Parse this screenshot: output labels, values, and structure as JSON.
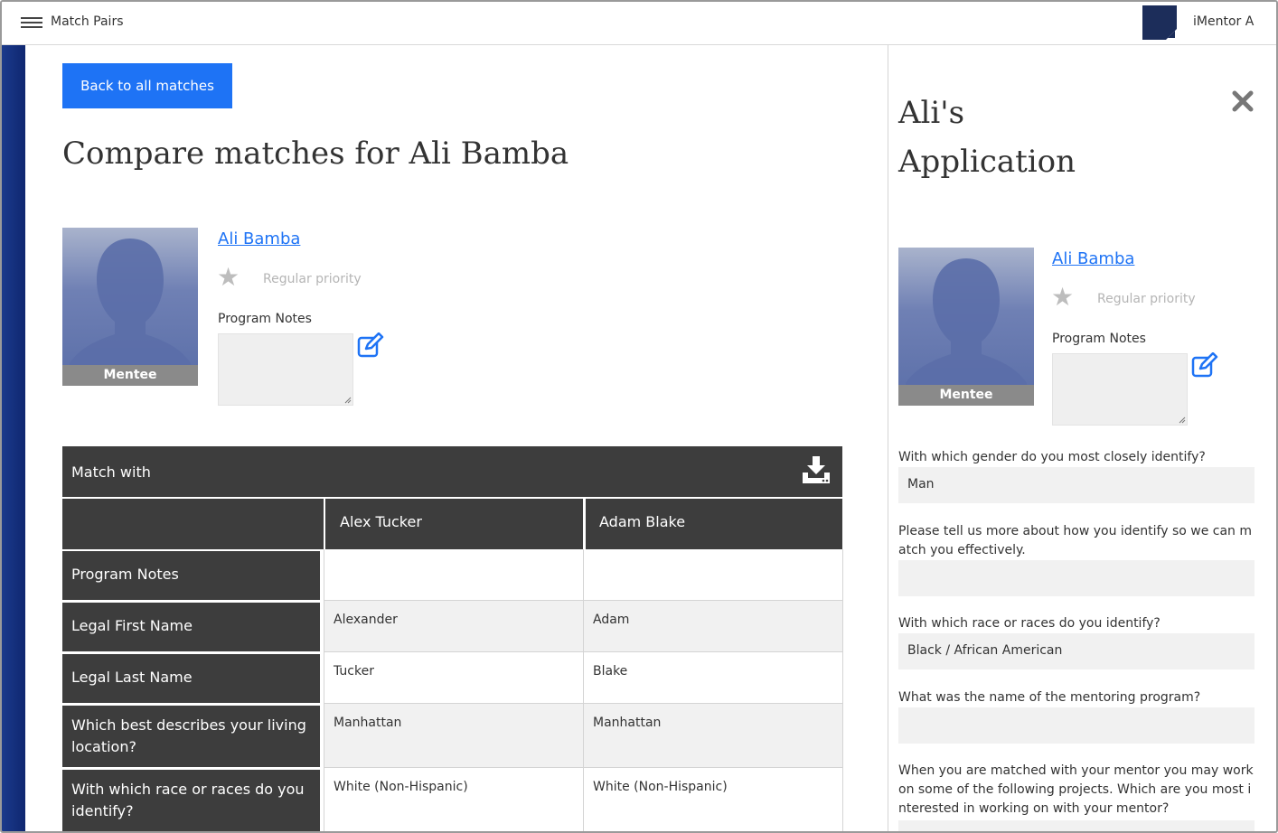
{
  "topbar": {
    "title": "Match Pairs",
    "user_name": "iMentor A"
  },
  "main": {
    "back_button": "Back to all matches",
    "page_title": "Compare matches for Ali Bamba",
    "profile": {
      "name": "Ali Bamba",
      "role": "Mentee",
      "priority": "Regular priority",
      "notes_label": "Program Notes",
      "notes_value": ""
    },
    "compare": {
      "header": "Match with",
      "columns": [
        "",
        "Alex Tucker",
        "Adam Blake"
      ],
      "rows": [
        {
          "label": "Program Notes",
          "values": [
            "",
            ""
          ]
        },
        {
          "label": "Legal First Name",
          "values": [
            "Alexander",
            "Adam"
          ]
        },
        {
          "label": "Legal Last Name",
          "values": [
            "Tucker",
            "Blake"
          ]
        },
        {
          "label": "Which best describes your living location?",
          "values": [
            "Manhattan",
            "Manhattan"
          ]
        },
        {
          "label": "With which race or races do you identify?",
          "values": [
            "White (Non-Hispanic)",
            "White (Non-Hispanic)"
          ]
        }
      ]
    }
  },
  "panel": {
    "title": "Ali's Application",
    "profile": {
      "name": "Ali Bamba",
      "role": "Mentee",
      "priority": "Regular priority",
      "notes_label": "Program Notes",
      "notes_value": ""
    },
    "questions": [
      {
        "question": "With which gender do you most closely identify?",
        "answer": "Man"
      },
      {
        "question": "Please tell us more about how you identify so we can match you effectively.",
        "answer": ""
      },
      {
        "question": "With which race or races do you identify?",
        "answer": "Black / African American"
      },
      {
        "question": "What was the name of the mentoring program?",
        "answer": ""
      },
      {
        "question": "When you are matched with your mentor you may work on some of the following projects. Which are you most interested in working on with your mentor?",
        "answer": ""
      }
    ]
  },
  "colors": {
    "accent_blue": "#1e73f5",
    "header_dark": "#3d3d3d",
    "sidebar_navy": "#1b3a8c"
  },
  "icons": [
    "hamburger-icon",
    "star-icon",
    "edit-icon",
    "download-icon",
    "close-icon"
  ]
}
